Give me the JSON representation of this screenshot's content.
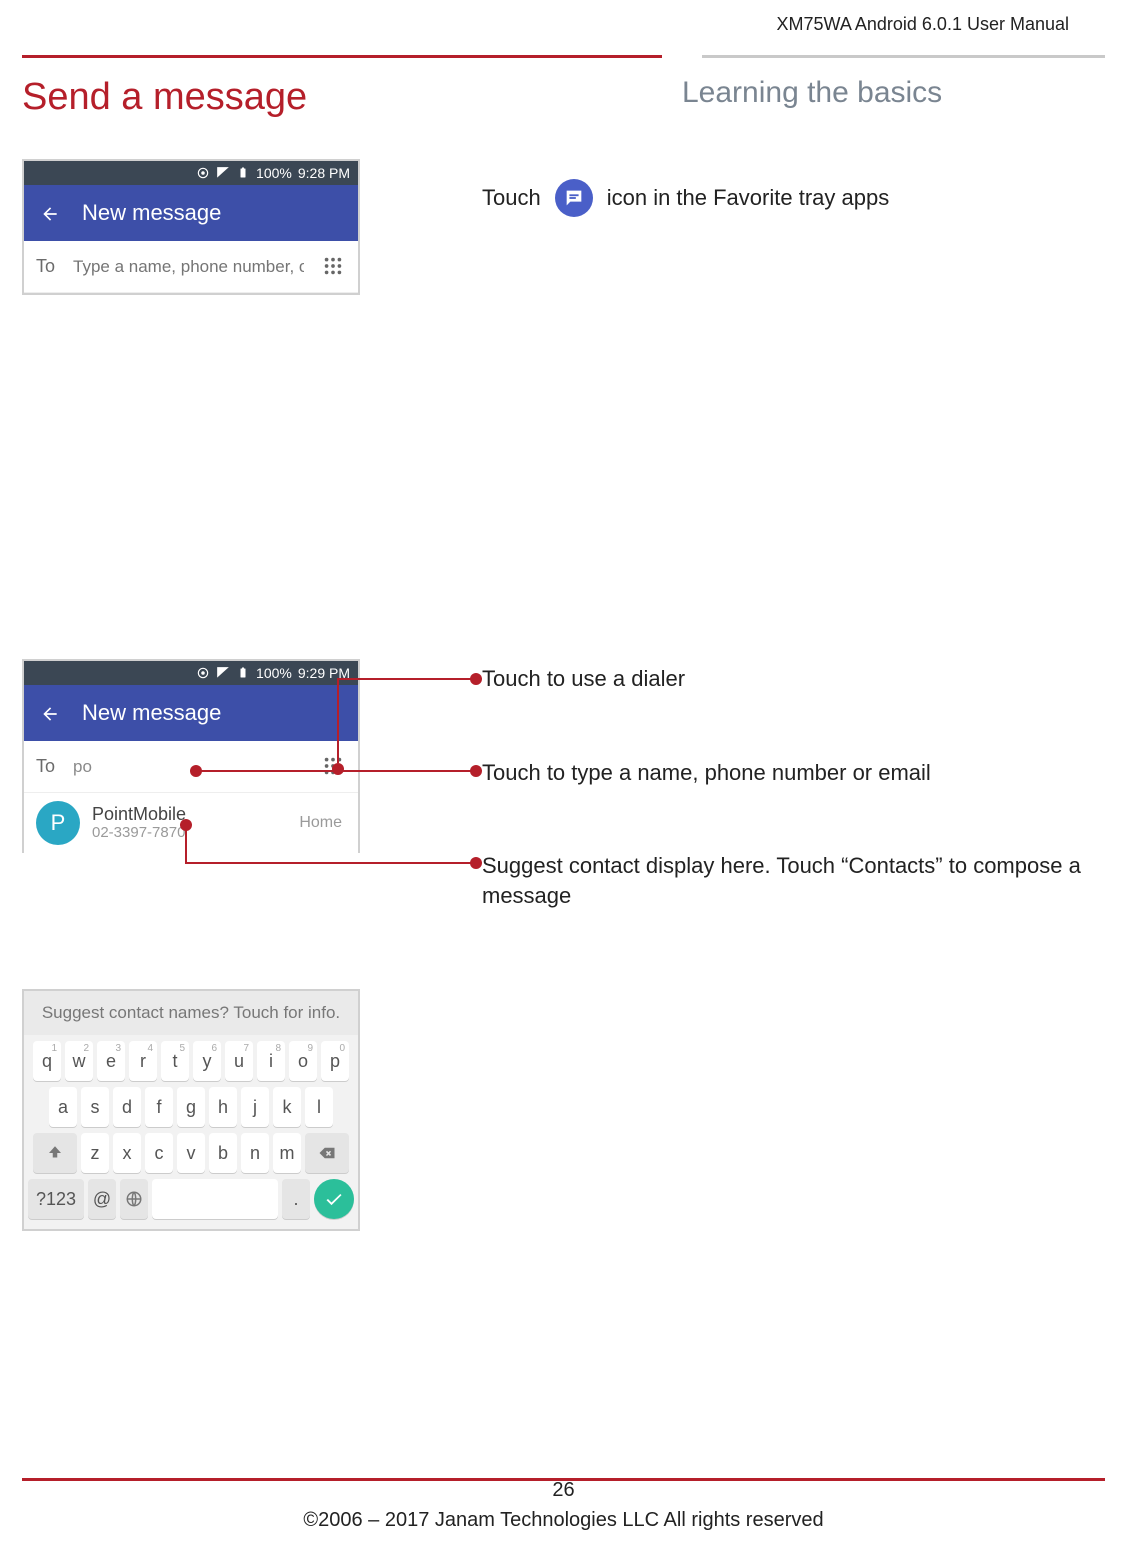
{
  "meta": {
    "doc_title": "XM75WA Android 6.0.1 User Manual",
    "page_num": "26",
    "copyright": "©2006 – 2017 Janam Technologies LLC All rights reserved"
  },
  "header": {
    "title": "Send a message",
    "subtitle": "Learning the basics"
  },
  "phone1": {
    "status": {
      "battery": "100%",
      "time": "9:28 PM"
    },
    "titlebar": "New message",
    "to_label": "To",
    "to_placeholder": "Type a name, phone number, or email"
  },
  "instruct1": {
    "pre": "Touch",
    "post": "icon in the Favorite tray apps"
  },
  "phone2": {
    "status": {
      "battery": "100%",
      "time": "9:29 PM"
    },
    "titlebar": "New message",
    "to_label": "To",
    "to_value": "po",
    "contact": {
      "initial": "P",
      "name": "PointMobile",
      "number": "02-3397-7870",
      "type": "Home"
    },
    "suggest": "Suggest contact names? Touch for info."
  },
  "callouts": {
    "c1": "Touch to use a dialer",
    "c2": "Touch to type a name, phone number or email",
    "c3": "Suggest contact display here. Touch “Contacts” to compose a message"
  },
  "keyboard": {
    "row1": [
      "q",
      "w",
      "e",
      "r",
      "t",
      "y",
      "u",
      "i",
      "o",
      "p"
    ],
    "row1sup": [
      "1",
      "2",
      "3",
      "4",
      "5",
      "6",
      "7",
      "8",
      "9",
      "0"
    ],
    "row2": [
      "a",
      "s",
      "d",
      "f",
      "g",
      "h",
      "j",
      "k",
      "l"
    ],
    "row3": [
      "z",
      "x",
      "c",
      "v",
      "b",
      "n",
      "m"
    ],
    "sym": "?123",
    "dot": "."
  }
}
